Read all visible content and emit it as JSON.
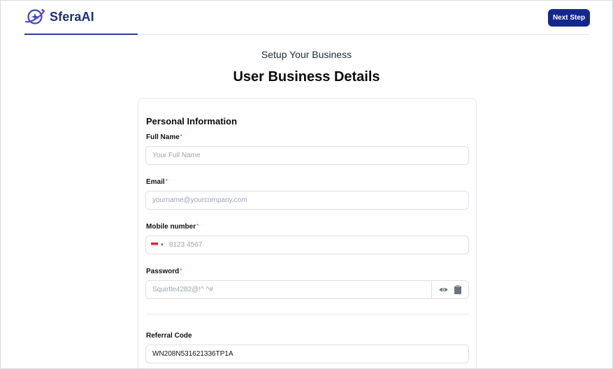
{
  "brand": {
    "name": "SferaAI"
  },
  "header": {
    "next_label": "Next Step"
  },
  "page": {
    "subtitle": "Setup Your Business",
    "title": "User Business Details"
  },
  "form": {
    "section_title": "Personal Information",
    "full_name": {
      "label": "Full Name",
      "placeholder": "Your Full Name",
      "required_mark": "*"
    },
    "email": {
      "label": "Email",
      "placeholder": "yourname@yourcompany.com",
      "required_mark": "*"
    },
    "mobile": {
      "label": "Mobile number",
      "placeholder": "8123 4567",
      "required_mark": "*",
      "country_flag": "singapore-flag-icon"
    },
    "password": {
      "label": "Password",
      "placeholder": "Squirtle4282@!^ ^#",
      "required_mark": "*"
    },
    "referral": {
      "label": "Referral Code",
      "value": "WN208N531621336TP1A"
    }
  },
  "colors": {
    "primary": "#14288c",
    "brand_text": "#1f2f7a",
    "required": "#e11d48"
  }
}
